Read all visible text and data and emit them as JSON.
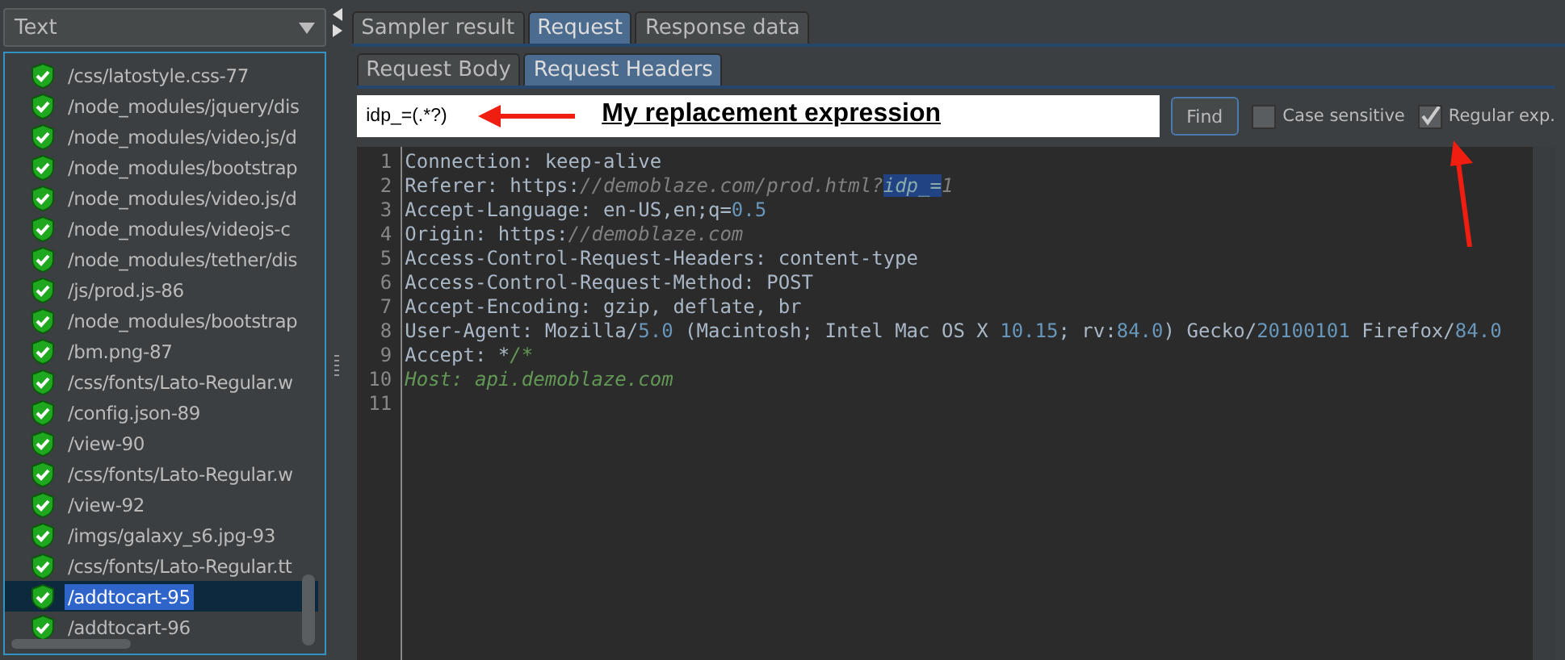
{
  "view_selector": {
    "value": "Text"
  },
  "tree": {
    "items": [
      {
        "label": "/css/latostyle.css-77",
        "selected": false
      },
      {
        "label": "/node_modules/jquery/dis",
        "selected": false
      },
      {
        "label": "/node_modules/video.js/d",
        "selected": false
      },
      {
        "label": "/node_modules/bootstrap",
        "selected": false
      },
      {
        "label": "/node_modules/video.js/d",
        "selected": false
      },
      {
        "label": "/node_modules/videojs-c",
        "selected": false
      },
      {
        "label": "/node_modules/tether/dis",
        "selected": false
      },
      {
        "label": "/js/prod.js-86",
        "selected": false
      },
      {
        "label": "/node_modules/bootstrap",
        "selected": false
      },
      {
        "label": "/bm.png-87",
        "selected": false
      },
      {
        "label": "/css/fonts/Lato-Regular.w",
        "selected": false
      },
      {
        "label": "/config.json-89",
        "selected": false
      },
      {
        "label": "/view-90",
        "selected": false
      },
      {
        "label": "/css/fonts/Lato-Regular.w",
        "selected": false
      },
      {
        "label": "/view-92",
        "selected": false
      },
      {
        "label": "/imgs/galaxy_s6.jpg-93",
        "selected": false
      },
      {
        "label": "/css/fonts/Lato-Regular.tt",
        "selected": false
      },
      {
        "label": "/addtocart-95",
        "selected": true
      },
      {
        "label": "/addtocart-96",
        "selected": false
      }
    ]
  },
  "tabs": [
    {
      "label": "Sampler result",
      "selected": false
    },
    {
      "label": "Request",
      "selected": true
    },
    {
      "label": "Response data",
      "selected": false
    }
  ],
  "subtabs": [
    {
      "label": "Request Body",
      "selected": false
    },
    {
      "label": "Request Headers",
      "selected": true
    }
  ],
  "search": {
    "value": "idp_=(.*?)",
    "button": "Find",
    "options": [
      {
        "label": "Case sensitive",
        "checked": false
      },
      {
        "label": "Regular exp.",
        "checked": true
      }
    ]
  },
  "annotation": {
    "text": "My replacement expression"
  },
  "editor": {
    "lines": [
      {
        "number": "1",
        "segments": [
          {
            "kind": "plain",
            "text": "Connection: keep-alive"
          }
        ]
      },
      {
        "number": "2",
        "segments": [
          {
            "kind": "plain",
            "text": "Referer: https:"
          },
          {
            "kind": "comment",
            "text": "//demoblaze.com/prod.html?"
          },
          {
            "kind": "highlight",
            "text": "idp_="
          },
          {
            "kind": "comment",
            "text": "1"
          }
        ]
      },
      {
        "number": "3",
        "segments": [
          {
            "kind": "plain",
            "text": "Accept-Language: en-US,en;q="
          },
          {
            "kind": "number",
            "text": "0.5"
          }
        ]
      },
      {
        "number": "4",
        "segments": [
          {
            "kind": "plain",
            "text": "Origin: https:"
          },
          {
            "kind": "comment",
            "text": "//demoblaze.com"
          }
        ]
      },
      {
        "number": "5",
        "segments": [
          {
            "kind": "plain",
            "text": "Access-Control-Request-Headers: content-type"
          }
        ]
      },
      {
        "number": "6",
        "segments": [
          {
            "kind": "plain",
            "text": "Access-Control-Request-Method: POST"
          }
        ]
      },
      {
        "number": "7",
        "segments": [
          {
            "kind": "plain",
            "text": "Accept-Encoding: gzip, deflate, br"
          }
        ]
      },
      {
        "number": "8",
        "segments": [
          {
            "kind": "plain",
            "text": "User-Agent: Mozilla/"
          },
          {
            "kind": "number",
            "text": "5.0"
          },
          {
            "kind": "plain",
            "text": " (Macintosh; Intel Mac OS X "
          },
          {
            "kind": "number",
            "text": "10.15"
          },
          {
            "kind": "plain",
            "text": "; rv:"
          },
          {
            "kind": "number",
            "text": "84.0"
          },
          {
            "kind": "plain",
            "text": ") Gecko/"
          },
          {
            "kind": "number",
            "text": "20100101"
          },
          {
            "kind": "plain",
            "text": " Firefox/"
          },
          {
            "kind": "number",
            "text": "84.0"
          }
        ]
      },
      {
        "number": "9",
        "segments": [
          {
            "kind": "plain",
            "text": "Accept: *"
          },
          {
            "kind": "green",
            "text": "/*"
          }
        ]
      },
      {
        "number": "10",
        "segments": [
          {
            "kind": "green",
            "text": "Host: api.demoblaze.com"
          }
        ]
      },
      {
        "number": "11"
      }
    ]
  }
}
